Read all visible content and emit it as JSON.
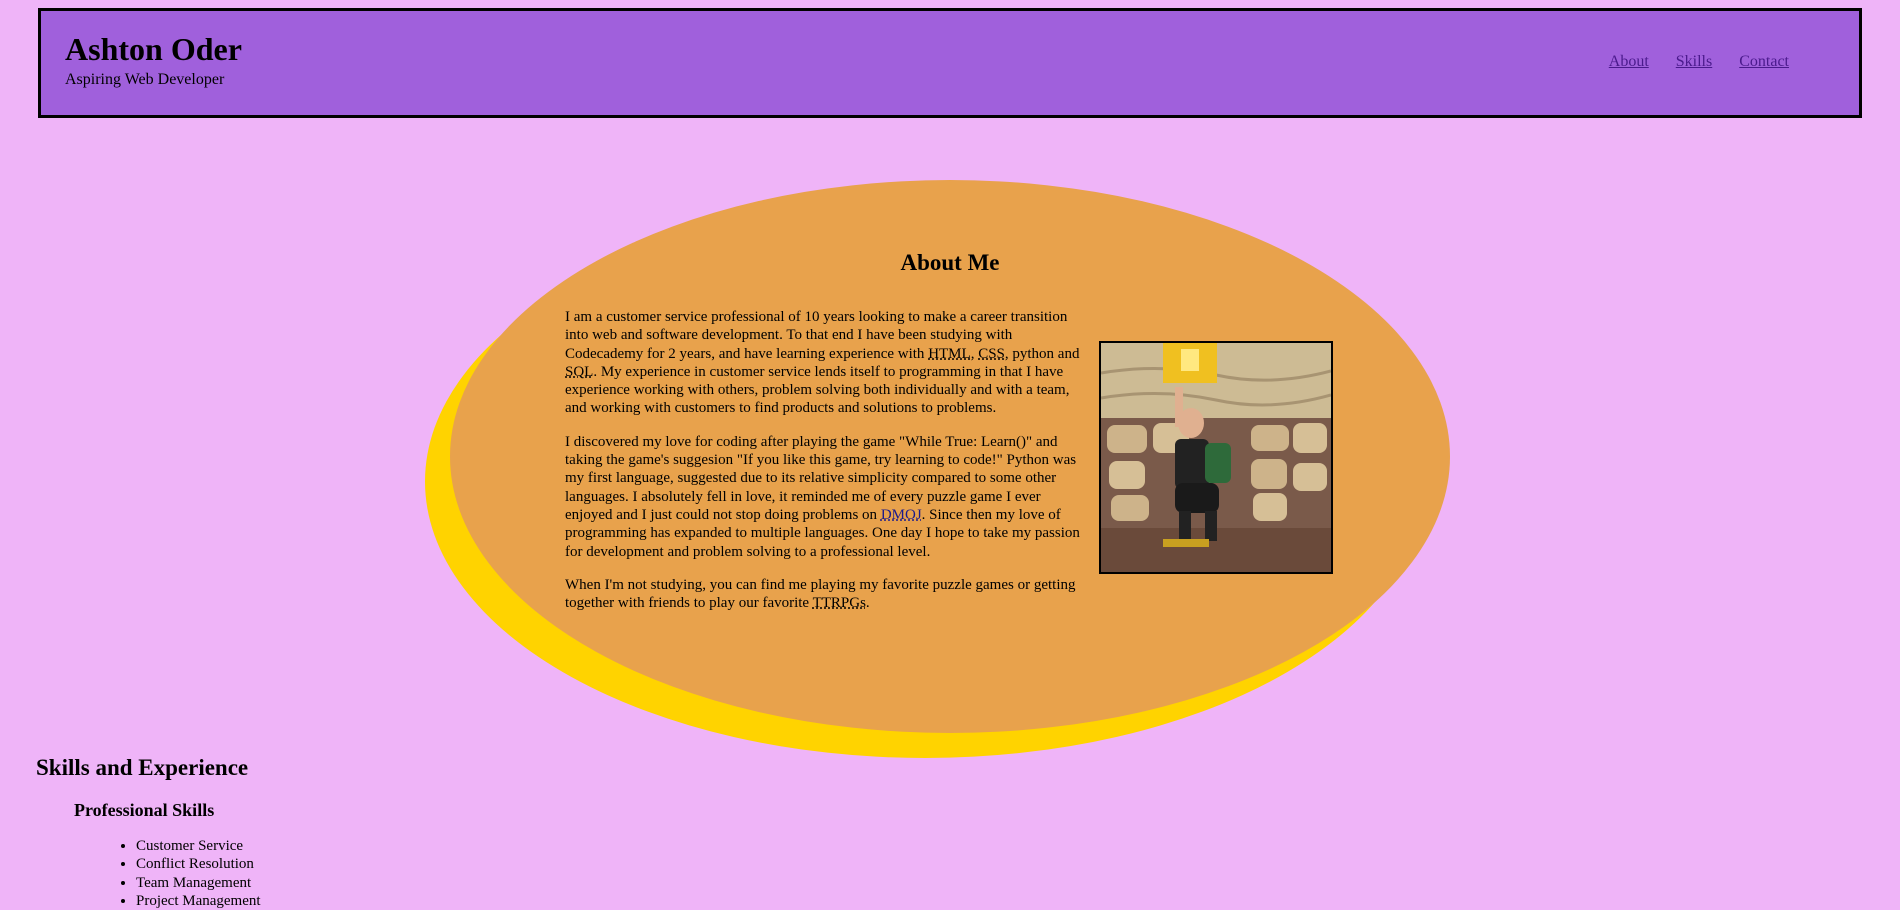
{
  "header": {
    "name": "Ashton Oder",
    "tagline": "Aspiring Web Developer",
    "nav": [
      {
        "label": "About"
      },
      {
        "label": "Skills"
      },
      {
        "label": "Contact"
      }
    ]
  },
  "about": {
    "title": "About Me",
    "p1": {
      "a": "I am a customer service professional of 10 years looking to make a career transition into web and software development. To that end I have been studying with Codecademy for 2 years, and have learning experience with ",
      "html": "HTML",
      "b": ", ",
      "css": "CSS",
      "c": ", python and ",
      "sql": "SQL",
      "d": ". My experience in customer service lends itself to programming in that I have experience working with others, problem solving both individually and with a team, and working with customers to find products and solutions to problems."
    },
    "p2": {
      "a": "I discovered my love for coding after playing the game \"While True: Learn()\" and taking the game's suggesion \"If you like this game, try learning to code!\" Python was my first language, suggested due to its relative simplicity compared to some other languages. I absolutely fell in love, it reminded me of every puzzle game I ever enjoyed and I just could not stop doing problems on ",
      "link": "DMOJ",
      "b": ". Since then my love of programming has expanded to multiple languages. One day I hope to take my passion for development and problem solving to a professional level."
    },
    "p3": {
      "a": "When I'm not studying, you can find me playing my favorite puzzle games or getting together with friends to play our favorite ",
      "ttrpg": "TTRPGs",
      "b": "."
    }
  },
  "skills": {
    "heading": "Skills and Experience",
    "subheading": "Professional Skills",
    "items": [
      "Customer Service",
      "Conflict Resolution",
      "Team Management",
      "Project Management"
    ]
  },
  "colors": {
    "page_bg": "#efb4f8",
    "header_bg": "#a060dc",
    "about_bg": "#e8a24c",
    "about_shadow": "#ffd300"
  }
}
